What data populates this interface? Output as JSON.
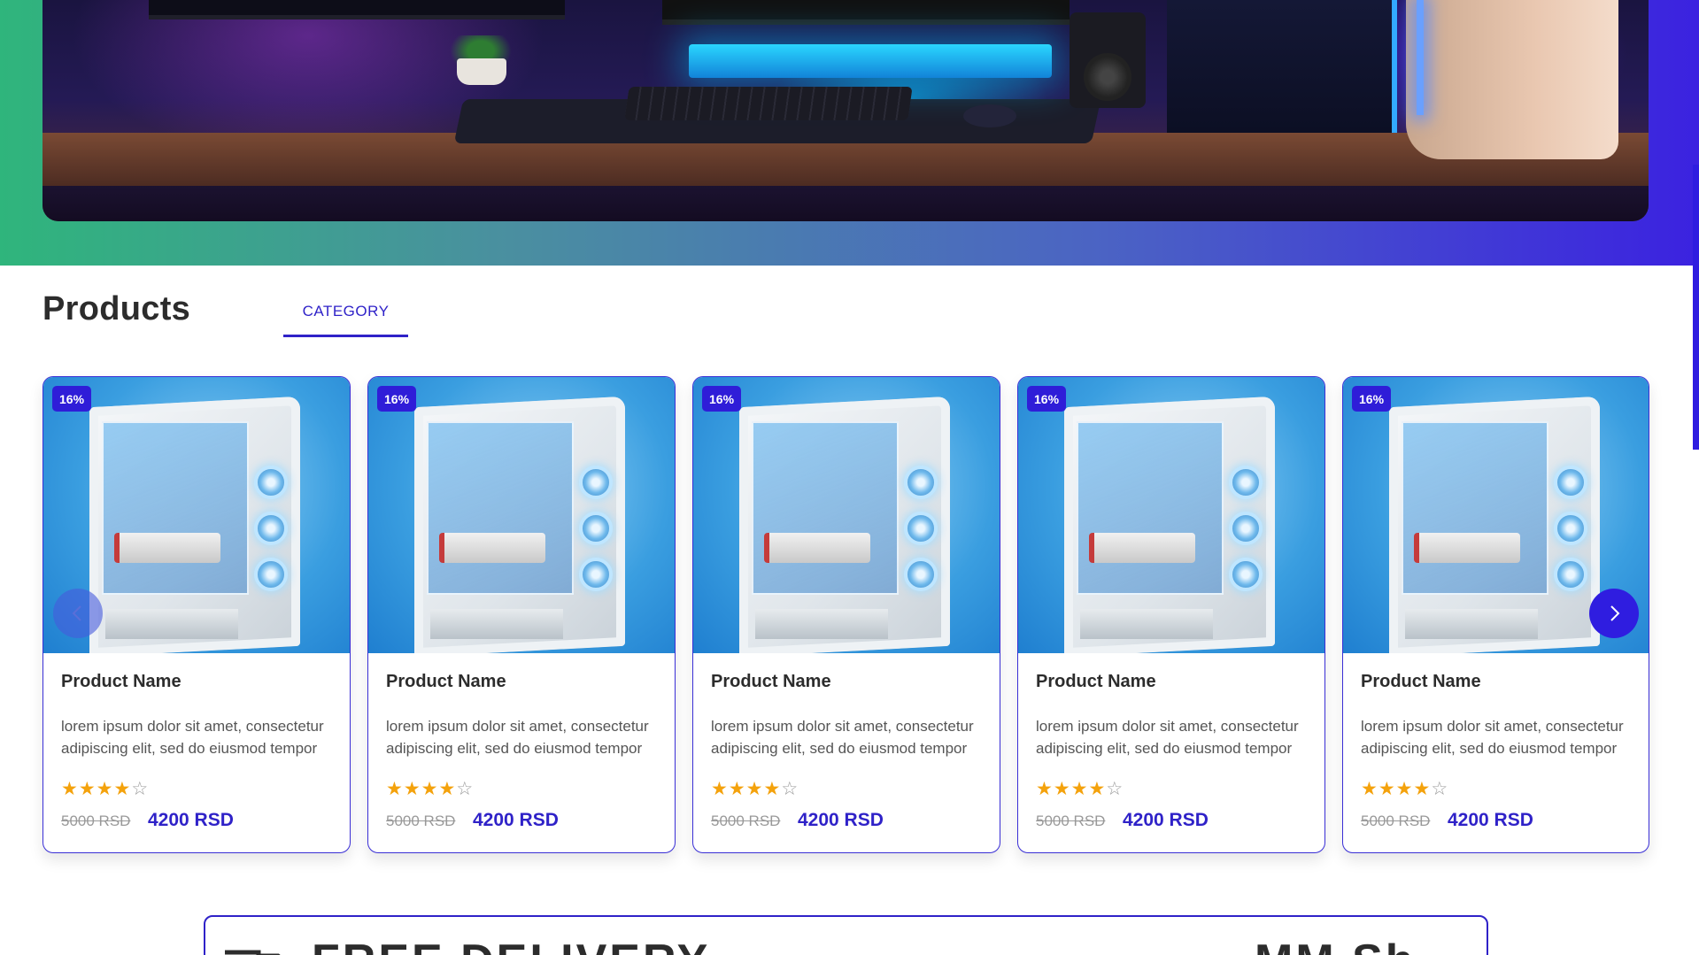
{
  "hero": {
    "image_alt": "gaming-desk-setup"
  },
  "products_section": {
    "title": "Products",
    "tabs": [
      {
        "label": "CATEGORY",
        "active": true
      }
    ],
    "carousel": {
      "prev_icon": "chevron-left-icon",
      "next_icon": "chevron-right-icon",
      "items": [
        {
          "badge": "16%",
          "name": "Product Name",
          "description": "lorem ipsum dolor sit amet, consectetur adipiscing elit, sed do eiusmod tempor",
          "rating": 4,
          "rating_max": 5,
          "old_price": "5000 RSD",
          "price": "4200 RSD"
        },
        {
          "badge": "16%",
          "name": "Product Name",
          "description": "lorem ipsum dolor sit amet, consectetur adipiscing elit, sed do eiusmod tempor",
          "rating": 4,
          "rating_max": 5,
          "old_price": "5000 RSD",
          "price": "4200 RSD"
        },
        {
          "badge": "16%",
          "name": "Product Name",
          "description": "lorem ipsum dolor sit amet, consectetur adipiscing elit, sed do eiusmod tempor",
          "rating": 4,
          "rating_max": 5,
          "old_price": "5000 RSD",
          "price": "4200 RSD"
        },
        {
          "badge": "16%",
          "name": "Product Name",
          "description": "lorem ipsum dolor sit amet, consectetur adipiscing elit, sed do eiusmod tempor",
          "rating": 4,
          "rating_max": 5,
          "old_price": "5000 RSD",
          "price": "4200 RSD"
        },
        {
          "badge": "16%",
          "name": "Product Name",
          "description": "lorem ipsum dolor sit amet, consectetur adipiscing elit, sed do eiusmod tempor",
          "rating": 4,
          "rating_max": 5,
          "old_price": "5000 RSD",
          "price": "4200 RSD"
        }
      ]
    }
  },
  "delivery": {
    "title": "FREE DELIVERY",
    "brand": "MM Sh",
    "icon": "truck-icon"
  },
  "colors": {
    "accent": "#2f22c8",
    "badge": "#2f1dd8",
    "star": "#f4a20c",
    "hero_gradient_start": "#2fb57c",
    "hero_gradient_end": "#3b22e0"
  }
}
